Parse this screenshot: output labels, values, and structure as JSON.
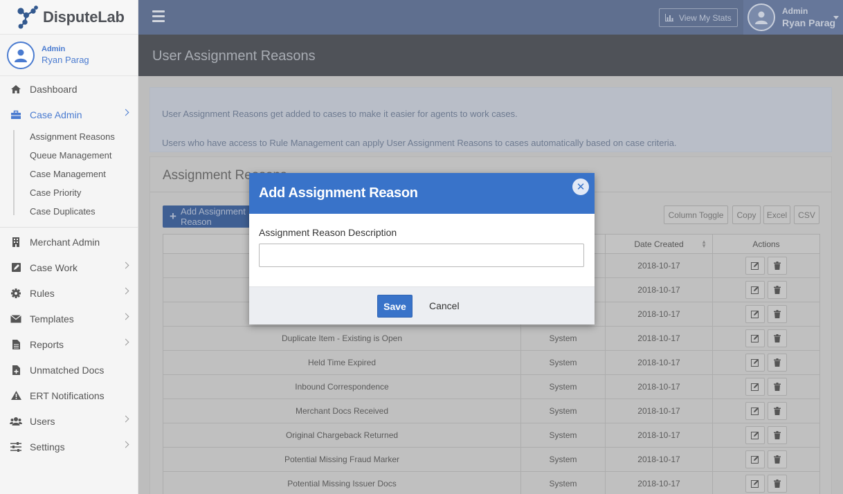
{
  "brand": {
    "name": "DisputeLab"
  },
  "user": {
    "role": "Admin",
    "name": "Ryan Parag"
  },
  "topbar": {
    "stats_label": "View My Stats"
  },
  "sidebar": {
    "items": [
      {
        "label": "Dashboard",
        "icon": "home-icon"
      },
      {
        "label": "Case Admin",
        "icon": "briefcase-icon",
        "active": true
      },
      {
        "label": "Merchant Admin",
        "icon": "building-icon"
      },
      {
        "label": "Case Work",
        "icon": "edit-icon"
      },
      {
        "label": "Rules",
        "icon": "gear-icon"
      },
      {
        "label": "Templates",
        "icon": "envelope-icon"
      },
      {
        "label": "Reports",
        "icon": "document-icon"
      },
      {
        "label": "Unmatched Docs",
        "icon": "file-plus-icon"
      },
      {
        "label": "ERT Notifications",
        "icon": "warning-icon"
      },
      {
        "label": "Users",
        "icon": "users-icon"
      },
      {
        "label": "Settings",
        "icon": "sliders-icon"
      }
    ],
    "case_admin_sub": [
      "Assignment Reasons",
      "Queue Management",
      "Case Management",
      "Case Priority",
      "Case Duplicates"
    ]
  },
  "page": {
    "title": "User Assignment Reasons",
    "info_line1": "User Assignment Reasons get added to cases to make it easier for agents to work cases.",
    "info_line2": "Users who have access to Rule Management can apply User Assignment Reasons to cases automatically based on case criteria."
  },
  "card": {
    "title": "Assignment Reasons",
    "add_label": "Add Assignment Reason",
    "buttons": [
      "Column Toggle",
      "Copy",
      "Excel",
      "CSV"
    ]
  },
  "table": {
    "headers": [
      "",
      "",
      "Date Created",
      "Actions"
    ],
    "rows": [
      {
        "description": "",
        "type": "",
        "date": "2018-10-17"
      },
      {
        "description": "",
        "type": "",
        "date": "2018-10-17"
      },
      {
        "description": "",
        "type": "",
        "date": "2018-10-17"
      },
      {
        "description": "Duplicate Item - Existing is Open",
        "type": "System",
        "date": "2018-10-17"
      },
      {
        "description": "Held Time Expired",
        "type": "System",
        "date": "2018-10-17"
      },
      {
        "description": "Inbound Correspondence",
        "type": "System",
        "date": "2018-10-17"
      },
      {
        "description": "Merchant Docs Received",
        "type": "System",
        "date": "2018-10-17"
      },
      {
        "description": "Original Chargeback Returned",
        "type": "System",
        "date": "2018-10-17"
      },
      {
        "description": "Potential Missing Fraud Marker",
        "type": "System",
        "date": "2018-10-17"
      },
      {
        "description": "Potential Missing Issuer Docs",
        "type": "System",
        "date": "2018-10-17"
      }
    ]
  },
  "modal": {
    "title": "Add Assignment Reason",
    "field_label": "Assignment Reason Description",
    "field_value": "",
    "field_placeholder": "",
    "save_label": "Save",
    "cancel_label": "Cancel"
  },
  "colors": {
    "accent": "#3973c9",
    "topbar": "#5f6f8f",
    "page_header": "#4f5258"
  }
}
